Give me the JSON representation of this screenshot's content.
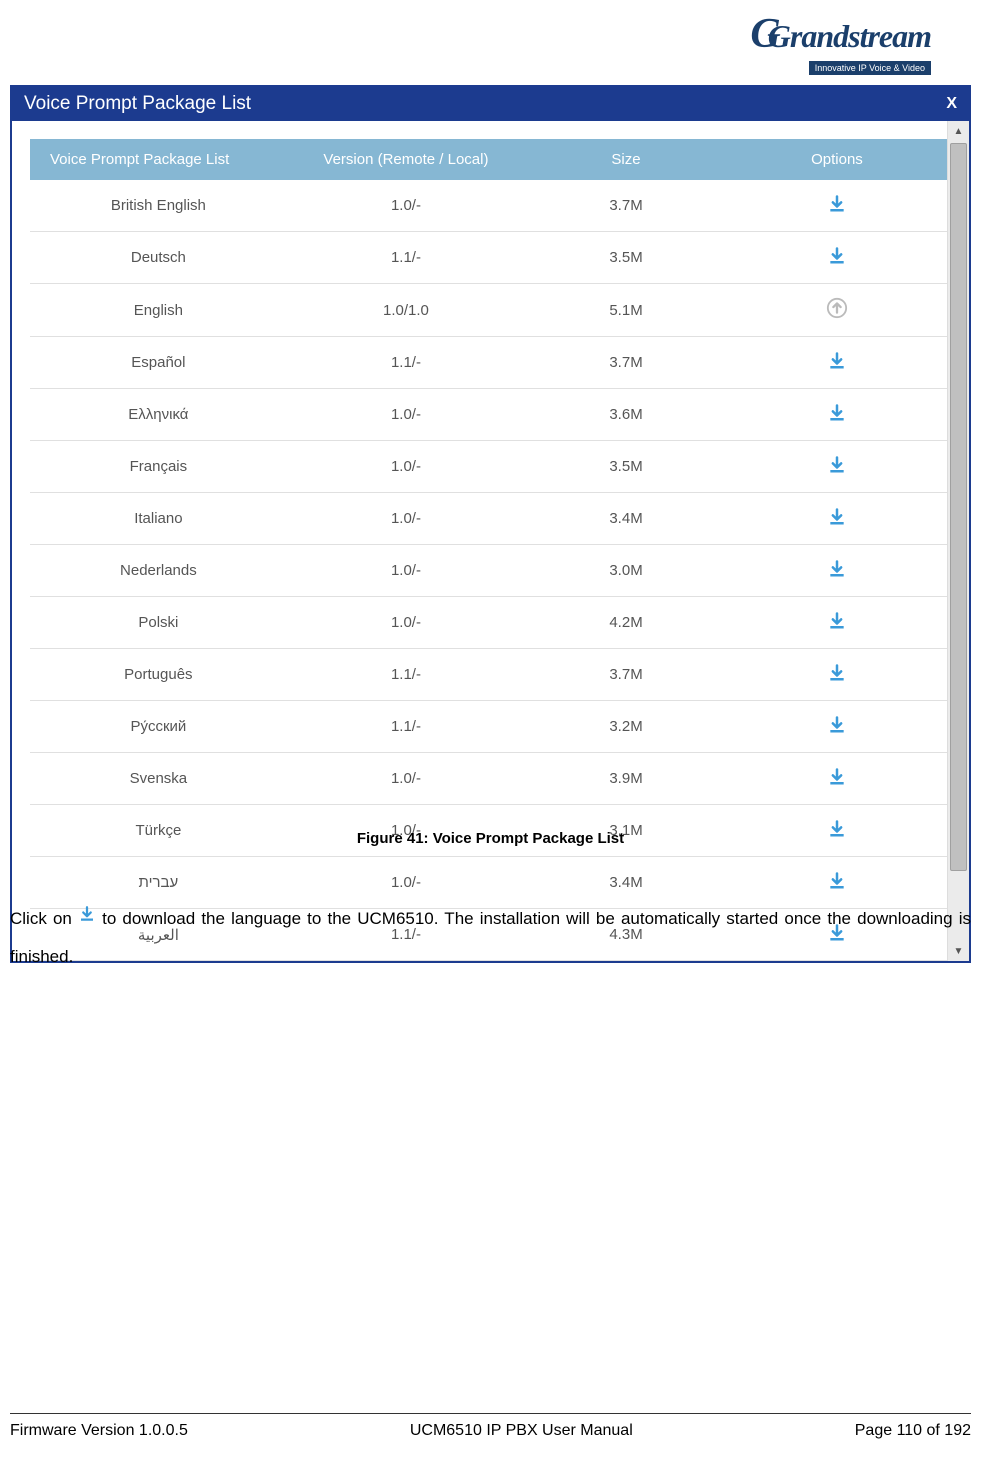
{
  "logo": {
    "text": "Grandstream",
    "tagline": "Innovative IP Voice & Video"
  },
  "dialog": {
    "title": "Voice Prompt Package List",
    "close": "X",
    "headers": {
      "col1": "Voice Prompt Package List",
      "col2": "Version (Remote / Local)",
      "col3": "Size",
      "col4": "Options"
    },
    "rows": [
      {
        "name": "British English",
        "version": "1.0/-",
        "size": "3.7M",
        "active": true
      },
      {
        "name": "Deutsch",
        "version": "1.1/-",
        "size": "3.5M",
        "active": true
      },
      {
        "name": "English",
        "version": "1.0/1.0",
        "size": "5.1M",
        "active": false
      },
      {
        "name": "Español",
        "version": "1.1/-",
        "size": "3.7M",
        "active": true
      },
      {
        "name": "Ελληνικά",
        "version": "1.0/-",
        "size": "3.6M",
        "active": true
      },
      {
        "name": "Français",
        "version": "1.0/-",
        "size": "3.5M",
        "active": true
      },
      {
        "name": "Italiano",
        "version": "1.0/-",
        "size": "3.4M",
        "active": true
      },
      {
        "name": "Nederlands",
        "version": "1.0/-",
        "size": "3.0M",
        "active": true
      },
      {
        "name": "Polski",
        "version": "1.0/-",
        "size": "4.2M",
        "active": true
      },
      {
        "name": "Português",
        "version": "1.1/-",
        "size": "3.7M",
        "active": true
      },
      {
        "name": "Ру́сский",
        "version": "1.1/-",
        "size": "3.2M",
        "active": true
      },
      {
        "name": "Svenska",
        "version": "1.0/-",
        "size": "3.9M",
        "active": true
      },
      {
        "name": "Türkçe",
        "version": "1.0/-",
        "size": "3.1M",
        "active": true
      },
      {
        "name": "עברית",
        "version": "1.0/-",
        "size": "3.4M",
        "active": true
      },
      {
        "name": "العربية",
        "version": "1.1/-",
        "size": "4.3M",
        "active": true
      }
    ]
  },
  "figure_caption": "Figure 41: Voice Prompt Package List",
  "body": {
    "part1": "Click on ",
    "part2": " to download the language to the UCM6510. The installation will be automatically started once the downloading is finished."
  },
  "footer": {
    "left": "Firmware Version 1.0.0.5",
    "center": "UCM6510 IP PBX User Manual",
    "right": "Page 110 of 192"
  }
}
